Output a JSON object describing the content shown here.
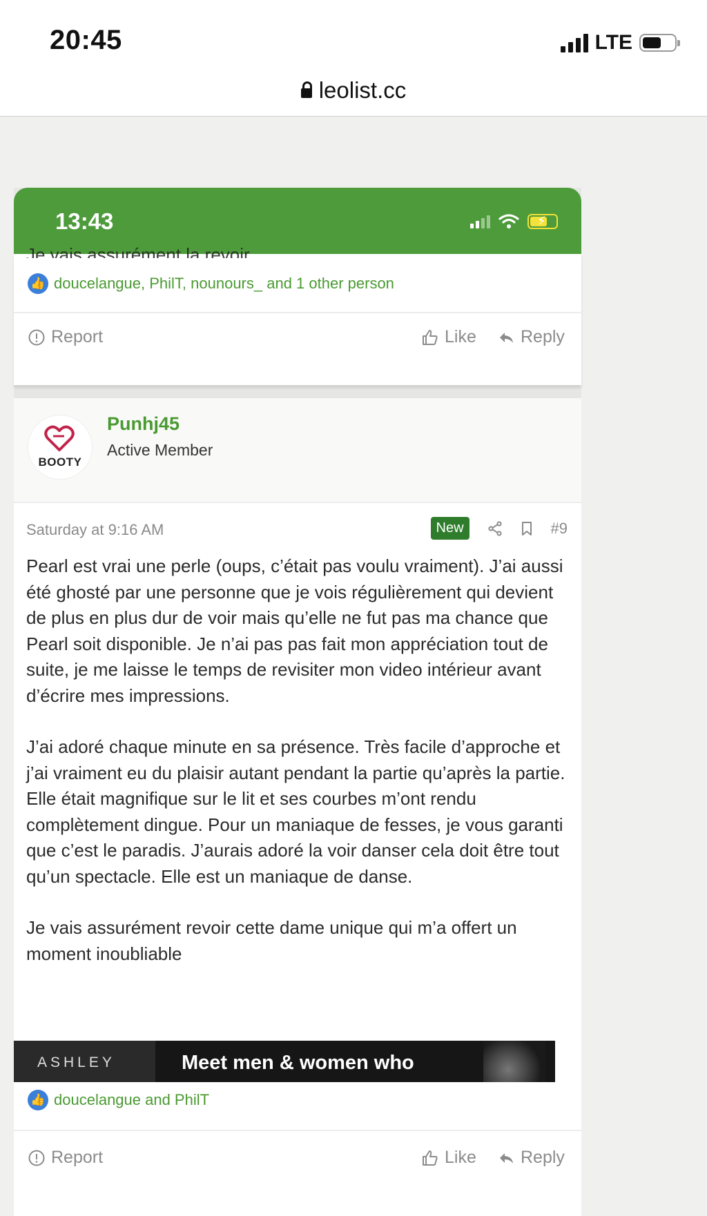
{
  "device": {
    "time": "20:45",
    "network": "LTE",
    "url": "leolist.cc"
  },
  "embedded": {
    "time": "13:43",
    "top_post": {
      "cut_text": "Je vais assurément la revoir",
      "likes_text": "doucelangue, PhilT, nounours_ and 1 other person",
      "report_label": "Report",
      "like_label": "Like",
      "reply_label": "Reply"
    },
    "post": {
      "username": "Punhj45",
      "role": "Active Member",
      "avatar_text": "BOOTY",
      "date": "Saturday at 9:16 AM",
      "badge": "New",
      "number": "#9",
      "paragraphs": [
        "Pearl est vrai une perle (oups, c’était pas voulu vraiment). J’ai aussi été ghosté par une personne que je vois régulièrement qui devient de plus en plus dur de voir mais qu’elle ne fut pas ma chance que Pearl soit disponible. Je n’ai pas pas fait mon appréciation tout de suite, je me laisse le temps de revisiter mon video intérieur avant d’écrire mes impressions.",
        "J’ai adoré chaque minute en sa présence. Très facile d’approche et j’ai vraiment eu du plaisir autant pendant la partie qu’après la partie. Elle était magnifique sur le lit et ses courbes m’ont rendu complètement dingue. Pour un maniaque de fesses, je vous garanti que c’est le paradis. J’aurais adoré la voir danser cela doit être tout qu’un spectacle. Elle est un maniaque de danse.",
        "Je vais assurément revoir cette dame unique qui m’a offert un moment inoubliable"
      ],
      "likes_text": "doucelangue and PhilT",
      "report_label": "Report",
      "like_label": "Like",
      "reply_label": "Reply"
    },
    "ad": {
      "brand": "ASHLEY",
      "headline": "Meet men & women who"
    }
  },
  "colors": {
    "accent_green": "#4d9b3a",
    "link_green": "#4a9a32",
    "badge_green": "#2f7d2c",
    "like_blue": "#3b7fd9"
  }
}
